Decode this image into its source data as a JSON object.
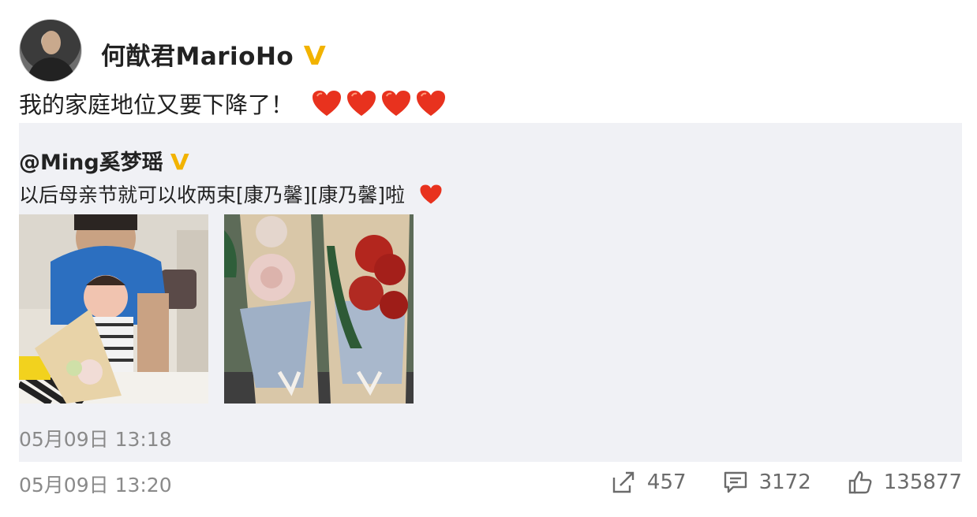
{
  "post": {
    "author": "何猷君MarioHo",
    "verified_mark": "V",
    "text": "我的家庭地位又要下降了！",
    "emoji_count": 4,
    "time": "05月09日 13:20",
    "actions": {
      "repost_count": "457",
      "comment_count": "3172",
      "like_count": "135877"
    }
  },
  "repost": {
    "author": "@Ming奚梦瑶",
    "verified_mark": "V",
    "text": "以后母亲节就可以收两束[康乃馨][康乃馨]啦",
    "time": "05月09日 13:18"
  },
  "colors": {
    "verified": "#f2b300",
    "heart": "#e8321e",
    "repost_bg": "#f0f1f5",
    "meta_text": "#8a8a8a"
  },
  "icons": [
    "avatar",
    "verified-icon",
    "heart-icon",
    "share-icon",
    "comment-icon",
    "like-icon"
  ]
}
